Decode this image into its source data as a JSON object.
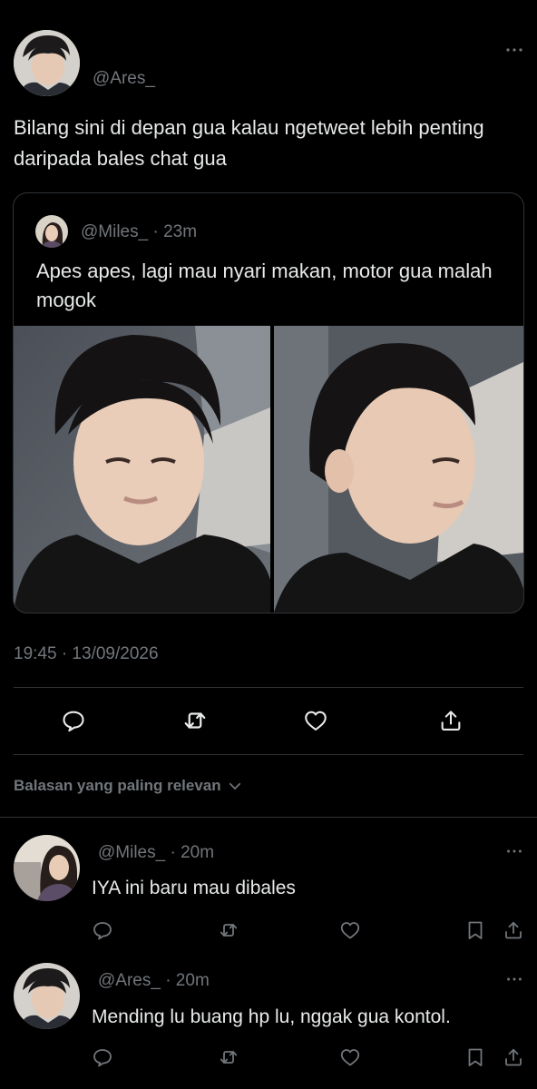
{
  "main_tweet": {
    "handle": "@Ares_",
    "text": "Bilang sini di depan gua kalau ngetweet lebih penting daripada bales chat gua",
    "timestamp": "19:45 · 13/09/2026"
  },
  "quoted_tweet": {
    "handle": "@Miles_",
    "time": "· 23m",
    "text": "Apes apes, lagi mau nyari makan, motor gua malah mogok"
  },
  "replies_sort": {
    "label": "Balasan yang paling relevan"
  },
  "replies": [
    {
      "handle": "@Miles_",
      "time": "· 20m",
      "text": "IYA ini baru mau dibales"
    },
    {
      "handle": "@Ares_",
      "time": "· 20m",
      "text": "Mending lu buang hp lu, nggak gua kontol."
    }
  ],
  "icons": {
    "more": "more-horizontal-icon",
    "reply": "reply-icon",
    "retweet": "retweet-icon",
    "like": "like-icon",
    "share": "share-icon",
    "bookmark": "bookmark-icon",
    "chevron": "chevron-down-icon"
  },
  "colors": {
    "background": "#000000",
    "text": "#e7e9ea",
    "muted": "#71767b",
    "divider": "#2f3336"
  }
}
